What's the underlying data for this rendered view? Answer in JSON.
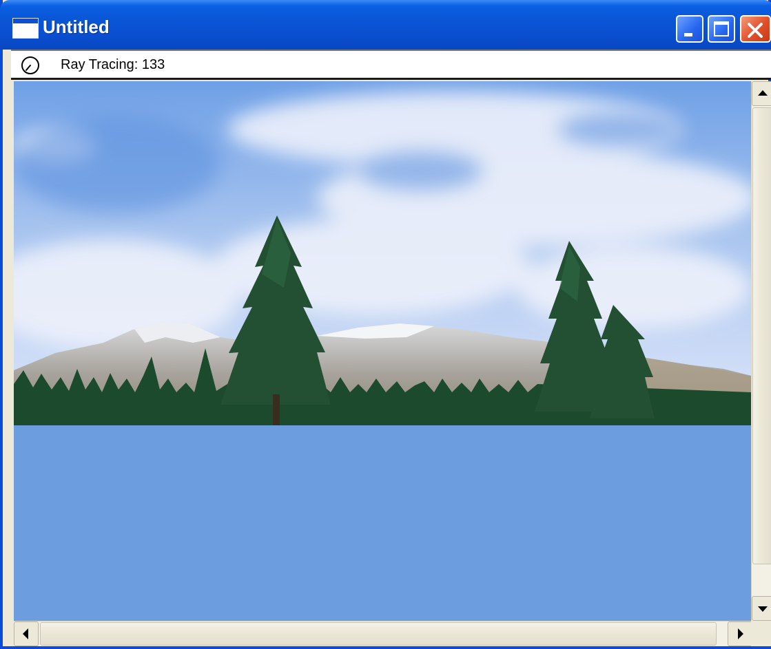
{
  "window": {
    "title": "Untitled",
    "controls": {
      "minimize": "minimize-icon",
      "maximize": "maximize-icon",
      "close": "close-icon"
    },
    "accent_color": "#0a4bd8",
    "close_color": "#e0502a"
  },
  "status": {
    "icon": "clock-icon",
    "text": "Ray Tracing: 133"
  },
  "render": {
    "description_icon": "rendered-image",
    "background_color": "#6c9ddf"
  },
  "scrollbars": {
    "vertical": {
      "up": "arrow-up-icon",
      "down": "arrow-down-icon"
    },
    "horizontal": {
      "left": "arrow-left-icon",
      "right": "arrow-right-icon"
    }
  }
}
